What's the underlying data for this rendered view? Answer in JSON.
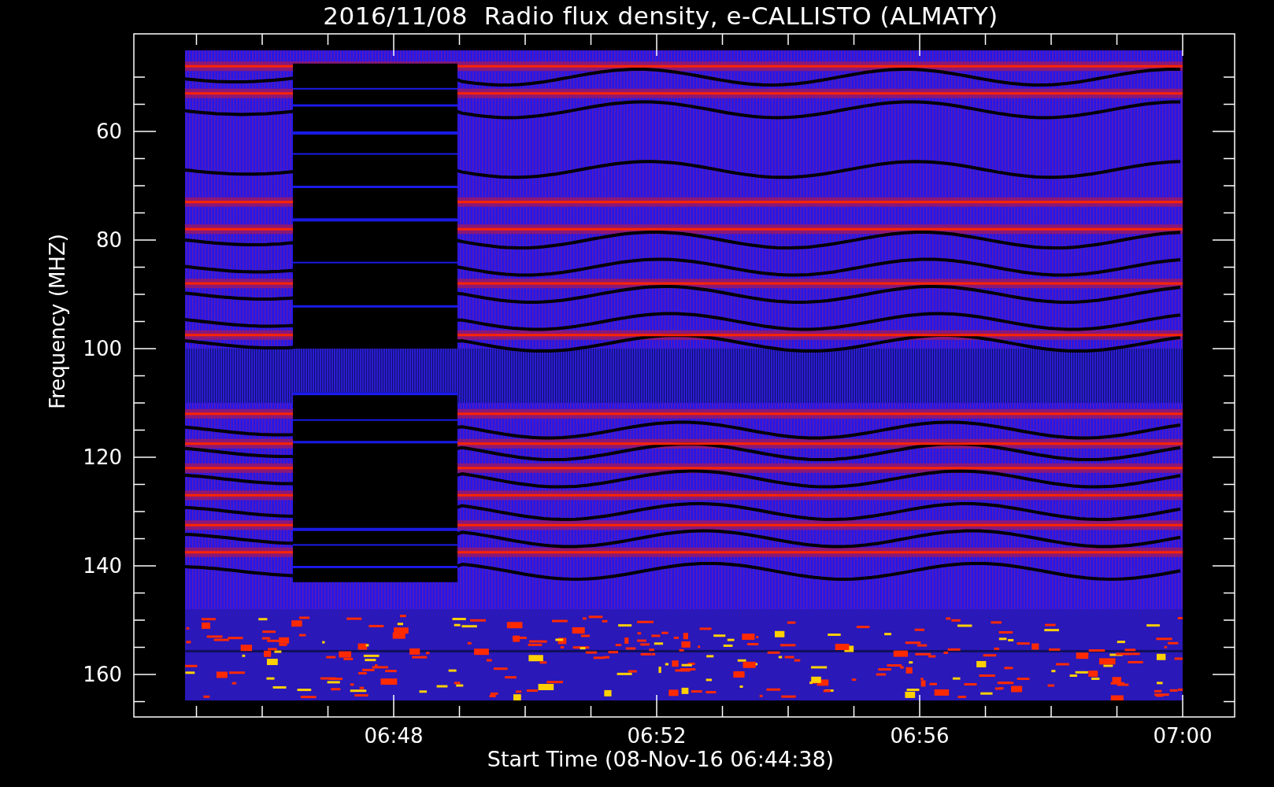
{
  "title": "2016/11/08  Radio flux density, e-CALLISTO (ALMATY)",
  "plot": {
    "ylabel": "Frequency (MHZ)",
    "yticks": [
      "60",
      "80",
      "100",
      "120",
      "140",
      "160"
    ],
    "xticks": [
      "06:48",
      "06:52",
      "06:56",
      "07:00"
    ],
    "xlabel": "Start Time (08-Nov-16 06:44:38)"
  }
}
